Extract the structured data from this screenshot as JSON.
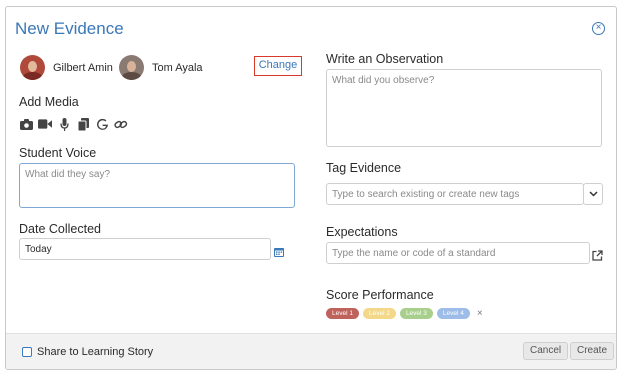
{
  "modal": {
    "title": "New Evidence",
    "close_icon": "circle-x-icon"
  },
  "students": [
    {
      "name": "Gilbert Amin",
      "avatar_colors": {
        "bg": "#b0493c",
        "shirt": "#7a2a22"
      }
    },
    {
      "name": "Tom Ayala",
      "avatar_colors": {
        "bg": "#8a7a72",
        "shirt": "#5c4a42"
      }
    }
  ],
  "change_label": "Change",
  "add_media": {
    "label": "Add Media",
    "icons": [
      "camera-icon",
      "video-icon",
      "microphone-icon",
      "documents-icon",
      "google-icon",
      "link-icon"
    ]
  },
  "student_voice": {
    "label": "Student Voice",
    "placeholder": "What did they say?"
  },
  "date_collected": {
    "label": "Date Collected",
    "value": "Today",
    "icon": "calendar-icon"
  },
  "observation": {
    "label": "Write an Observation",
    "placeholder": "What did you observe?"
  },
  "tag_evidence": {
    "label": "Tag Evidence",
    "placeholder": "Type to search existing or create new tags"
  },
  "expectations": {
    "label": "Expectations",
    "placeholder": "Type the name or code of a standard"
  },
  "score": {
    "label": "Score Performance",
    "levels": [
      {
        "label": "Level 1",
        "color": "#c0625c"
      },
      {
        "label": "Level 2",
        "color": "#f3d889"
      },
      {
        "label": "Level 3",
        "color": "#a8cf8c"
      },
      {
        "label": "Level 4",
        "color": "#9dbde8"
      }
    ],
    "clear": "×"
  },
  "footer": {
    "share_label": "Share to Learning Story",
    "cancel_label": "Cancel",
    "create_label": "Create"
  },
  "colors": {
    "accent": "#3a78b8",
    "highlight": "#d9392b"
  }
}
